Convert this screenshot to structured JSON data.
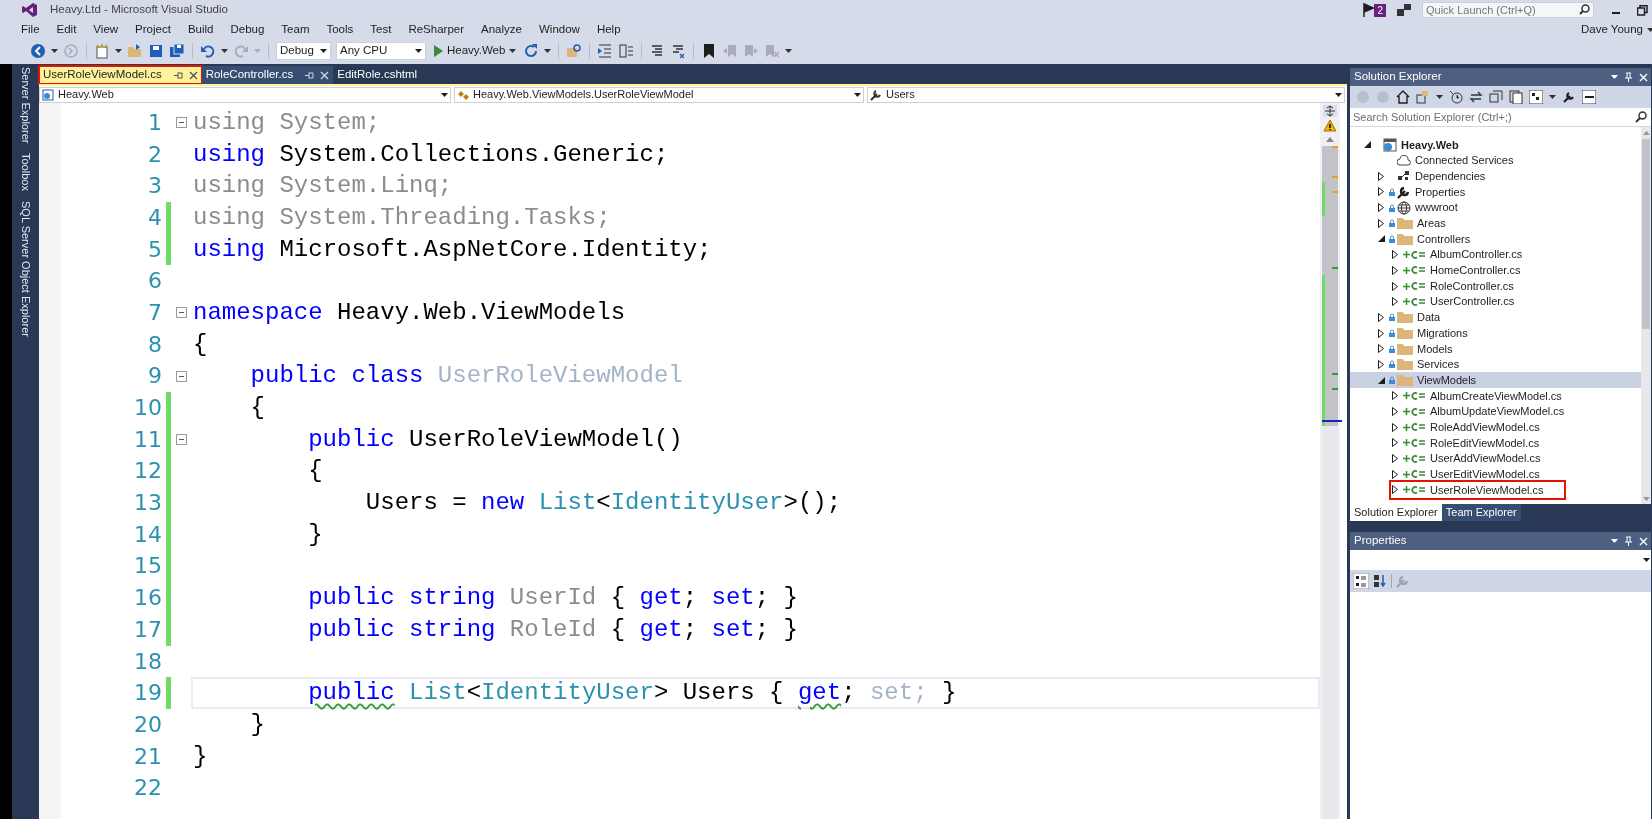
{
  "window": {
    "title": "Heavy.Ltd - Microsoft Visual Studio",
    "notification_count": "2",
    "quick_launch": {
      "placeholder": "Quick Launch (Ctrl+Q)"
    },
    "user": "Dave Young"
  },
  "menu": [
    "File",
    "Edit",
    "View",
    "Project",
    "Build",
    "Debug",
    "Team",
    "Tools",
    "Test",
    "ReSharper",
    "Analyze",
    "Window",
    "Help"
  ],
  "toolbar": {
    "configuration": "Debug",
    "platform": "Any CPU",
    "start": "Heavy.Web"
  },
  "side_tabs": [
    "Server Explorer",
    "Toolbox",
    "SQL Server Object Explorer"
  ],
  "tabs": [
    {
      "label": "UserRoleViewModel.cs",
      "selected": true,
      "pinnable": true,
      "marked": true
    },
    {
      "label": "RoleController.cs",
      "selected": false,
      "pinnable": true,
      "marked": false
    },
    {
      "label": "EditRole.cshtml",
      "selected": false,
      "pinnable": false,
      "marked": false
    }
  ],
  "navigation": {
    "project": "Heavy.Web",
    "type": "Heavy.Web.ViewModels.UserRoleViewModel",
    "member": "Users"
  },
  "code": [
    {
      "number": "1",
      "fold": true,
      "changed": false,
      "current": false,
      "tokens": [
        {
          "text": "using System;",
          "kind": "unused"
        }
      ]
    },
    {
      "number": "2",
      "fold": false,
      "changed": false,
      "current": false,
      "tokens": [
        {
          "text": "using",
          "kind": "keyword"
        },
        {
          "text": " System.Collections.Generic;",
          "kind": "plain"
        }
      ]
    },
    {
      "number": "3",
      "fold": false,
      "changed": false,
      "current": false,
      "tokens": [
        {
          "text": "using System.Linq;",
          "kind": "unused"
        }
      ]
    },
    {
      "number": "4",
      "fold": false,
      "changed": true,
      "current": false,
      "tokens": [
        {
          "text": "using System.Threading.Tasks;",
          "kind": "unused"
        }
      ]
    },
    {
      "number": "5",
      "fold": false,
      "changed": true,
      "current": false,
      "tokens": [
        {
          "text": "using",
          "kind": "keyword"
        },
        {
          "text": " Microsoft.AspNetCore.Identity;",
          "kind": "plain"
        }
      ]
    },
    {
      "number": "6",
      "fold": false,
      "changed": false,
      "current": false
    },
    {
      "number": "7",
      "fold": true,
      "changed": false,
      "current": false,
      "tokens": [
        {
          "text": "namespace",
          "kind": "keyword"
        },
        {
          "text": " Heavy.Web.ViewModels",
          "kind": "plain"
        }
      ]
    },
    {
      "number": "8",
      "fold": false,
      "changed": false,
      "current": false,
      "tokens": [
        {
          "text": "{",
          "kind": "plain"
        }
      ]
    },
    {
      "number": "9",
      "fold": true,
      "changed": false,
      "current": false,
      "tokens": [
        {
          "text": "    public class",
          "kind": "keyword"
        },
        {
          "text": " UserRoleViewModel",
          "kind": "faded"
        }
      ]
    },
    {
      "number": "10",
      "fold": false,
      "changed": true,
      "current": false,
      "tokens": [
        {
          "text": "    {",
          "kind": "plain"
        }
      ]
    },
    {
      "number": "11",
      "fold": true,
      "changed": true,
      "current": false,
      "tokens": [
        {
          "text": "        public",
          "kind": "keyword"
        },
        {
          "text": " UserRoleViewModel()",
          "kind": "plain"
        }
      ]
    },
    {
      "number": "12",
      "fold": false,
      "changed": true,
      "current": false,
      "tokens": [
        {
          "text": "        {",
          "kind": "plain"
        }
      ]
    },
    {
      "number": "13",
      "fold": false,
      "changed": true,
      "current": false,
      "tokens": [
        {
          "text": "            Users = ",
          "kind": "plain"
        },
        {
          "text": "new",
          "kind": "keyword"
        },
        {
          "text": " List",
          "kind": "type"
        },
        {
          "text": "<",
          "kind": "plain"
        },
        {
          "text": "IdentityUser",
          "kind": "type"
        },
        {
          "text": ">();",
          "kind": "plain"
        }
      ]
    },
    {
      "number": "14",
      "fold": false,
      "changed": true,
      "current": false,
      "tokens": [
        {
          "text": "        }",
          "kind": "plain"
        }
      ]
    },
    {
      "number": "15",
      "fold": false,
      "changed": true,
      "current": false
    },
    {
      "number": "16",
      "fold": false,
      "changed": true,
      "current": false,
      "tokens": [
        {
          "text": "        public string",
          "kind": "keyword"
        },
        {
          "text": " UserId",
          "kind": "unused"
        },
        {
          "text": " { ",
          "kind": "plain"
        },
        {
          "text": "get",
          "kind": "keyword"
        },
        {
          "text": "; ",
          "kind": "plain"
        },
        {
          "text": "set",
          "kind": "keyword"
        },
        {
          "text": "; }",
          "kind": "plain"
        }
      ]
    },
    {
      "number": "17",
      "fold": false,
      "changed": true,
      "current": false,
      "tokens": [
        {
          "text": "        public string",
          "kind": "keyword"
        },
        {
          "text": " RoleId",
          "kind": "unused"
        },
        {
          "text": " { ",
          "kind": "plain"
        },
        {
          "text": "get",
          "kind": "keyword"
        },
        {
          "text": "; ",
          "kind": "plain"
        },
        {
          "text": "set",
          "kind": "keyword"
        },
        {
          "text": "; }",
          "kind": "plain"
        }
      ]
    },
    {
      "number": "18",
      "fold": false,
      "changed": false,
      "current": false
    },
    {
      "number": "19",
      "fold": false,
      "changed": true,
      "current": true,
      "tokens": [
        {
          "text": "        public",
          "kind": "keyword",
          "squiggle": true
        },
        {
          "text": " List",
          "kind": "type"
        },
        {
          "text": "<",
          "kind": "plain"
        },
        {
          "text": "IdentityUser",
          "kind": "type"
        },
        {
          "text": "> Users { ",
          "kind": "plain"
        },
        {
          "text": "get",
          "kind": "keyword",
          "squiggle": true
        },
        {
          "text": ";",
          "kind": "plain"
        },
        {
          "text": " set;",
          "kind": "faded"
        },
        {
          "text": " }",
          "kind": "plain"
        }
      ]
    },
    {
      "number": "20",
      "fold": false,
      "changed": false,
      "current": false,
      "tokens": [
        {
          "text": "    }",
          "kind": "plain"
        }
      ]
    },
    {
      "number": "21",
      "fold": false,
      "changed": false,
      "current": false,
      "tokens": [
        {
          "text": "}",
          "kind": "plain"
        }
      ]
    },
    {
      "number": "22",
      "fold": false,
      "changed": false,
      "current": false
    }
  ],
  "solution_explorer": {
    "title": "Solution Explorer",
    "search": {
      "placeholder": "Search Solution Explorer (Ctrl+;)"
    },
    "tree": [
      {
        "label": "Heavy.Web",
        "kind": "project",
        "expanded": true,
        "selected": false,
        "marked": false,
        "children": [
          {
            "label": "Connected Services",
            "kind": "service",
            "selected": false,
            "marked": false
          },
          {
            "label": "Dependencies",
            "kind": "dependencies",
            "expanded": false,
            "selected": false,
            "marked": false
          },
          {
            "label": "Properties",
            "kind": "properties",
            "locked": true,
            "expanded": false,
            "selected": false,
            "marked": false
          },
          {
            "label": "wwwroot",
            "kind": "web",
            "locked": true,
            "expanded": false,
            "selected": false,
            "marked": false
          },
          {
            "label": "Areas",
            "kind": "folder",
            "locked": true,
            "expanded": false,
            "selected": false,
            "marked": false
          },
          {
            "label": "Controllers",
            "kind": "folder",
            "locked": true,
            "expanded": true,
            "selected": false,
            "marked": false,
            "children": [
              {
                "label": "AlbumController.cs",
                "kind": "file",
                "pending_add": true,
                "expanded": false,
                "selected": false,
                "marked": false
              },
              {
                "label": "HomeController.cs",
                "kind": "file",
                "pending_add": true,
                "expanded": false,
                "selected": false,
                "marked": false
              },
              {
                "label": "RoleController.cs",
                "kind": "file",
                "pending_add": true,
                "expanded": false,
                "selected": false,
                "marked": false
              },
              {
                "label": "UserController.cs",
                "kind": "file",
                "pending_add": true,
                "expanded": false,
                "selected": false,
                "marked": false
              }
            ]
          },
          {
            "label": "Data",
            "kind": "folder",
            "locked": true,
            "expanded": false,
            "selected": false,
            "marked": false
          },
          {
            "label": "Migrations",
            "kind": "folder",
            "locked": true,
            "expanded": false,
            "selected": false,
            "marked": false
          },
          {
            "label": "Models",
            "kind": "folder",
            "locked": true,
            "expanded": false,
            "selected": false,
            "marked": false
          },
          {
            "label": "Services",
            "kind": "folder",
            "locked": true,
            "expanded": false,
            "selected": false,
            "marked": false
          },
          {
            "label": "ViewModels",
            "kind": "folder",
            "locked": true,
            "expanded": true,
            "selected": true,
            "marked": false,
            "children": [
              {
                "label": "AlbumCreateViewModel.cs",
                "kind": "file",
                "pending_add": true,
                "expanded": false,
                "selected": false,
                "marked": false
              },
              {
                "label": "AlbumUpdateViewModel.cs",
                "kind": "file",
                "pending_add": true,
                "expanded": false,
                "selected": false,
                "marked": false
              },
              {
                "label": "RoleAddViewModel.cs",
                "kind": "file",
                "pending_add": true,
                "expanded": false,
                "selected": false,
                "marked": false
              },
              {
                "label": "RoleEditViewModel.cs",
                "kind": "file",
                "pending_add": true,
                "expanded": false,
                "selected": false,
                "marked": false
              },
              {
                "label": "UserAddViewModel.cs",
                "kind": "file",
                "pending_add": true,
                "expanded": false,
                "selected": false,
                "marked": false
              },
              {
                "label": "UserEditViewModel.cs",
                "kind": "file",
                "pending_add": true,
                "expanded": false,
                "selected": false,
                "marked": false
              },
              {
                "label": "UserRoleViewModel.cs",
                "kind": "file",
                "pending_add": true,
                "expanded": false,
                "selected": false,
                "marked": true
              }
            ]
          }
        ]
      }
    ]
  },
  "panel_tabs": [
    {
      "label": "Solution Explorer",
      "selected": true
    },
    {
      "label": "Team Explorer",
      "selected": false
    }
  ],
  "properties": {
    "title": "Properties"
  }
}
